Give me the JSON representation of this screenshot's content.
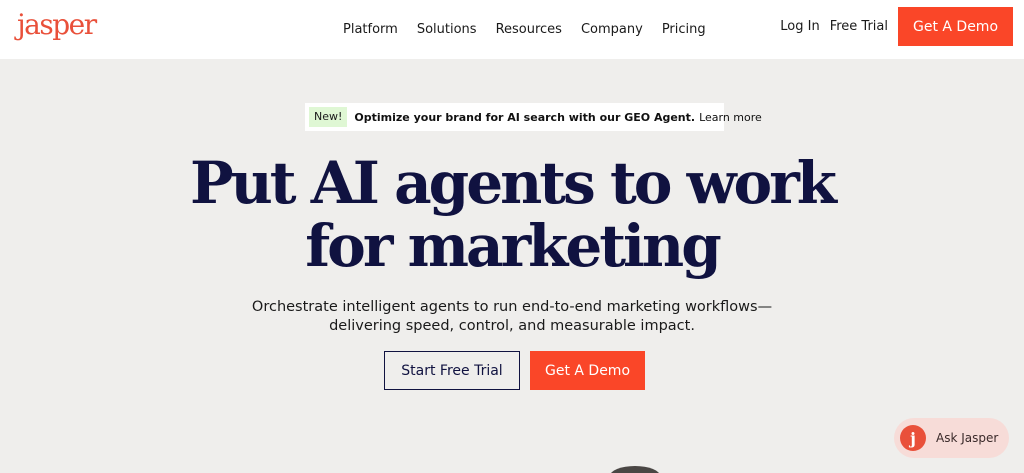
{
  "header": {
    "logo": "jasper",
    "nav": [
      "Platform",
      "Solutions",
      "Resources",
      "Company",
      "Pricing"
    ],
    "login": "Log In",
    "free_trial": "Free Trial",
    "demo": "Get A Demo"
  },
  "announcement": {
    "badge": "New!",
    "text": "Optimize your brand for AI search with our GEO Agent.",
    "link": "Learn more",
    "icon": "arrow-right-icon"
  },
  "hero": {
    "title_line1": "Put AI agents to work",
    "title_line2": "for marketing",
    "subtitle_line1": "Orchestrate intelligent agents to run end-to-end marketing workflows—",
    "subtitle_line2": "delivering speed, control, and measurable impact.",
    "cta_primary": "Start Free Trial",
    "cta_secondary": "Get A Demo"
  },
  "chat": {
    "icon_letter": "j",
    "label": "Ask Jasper"
  },
  "colors": {
    "accent": "#fa4628",
    "brand": "#e9503a",
    "navy": "#101240",
    "background": "#efeeec",
    "badge_bg": "#dff7d4"
  }
}
